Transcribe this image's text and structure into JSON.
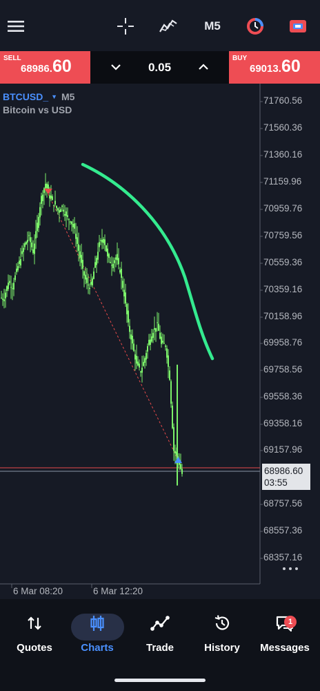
{
  "toolbar": {
    "menu_icon": "hamburger-icon",
    "crosshair_icon": "crosshair-icon",
    "indicators_icon": "indicators-icon",
    "timeframe": "M5",
    "chart_settings_icon": "chart-settings-icon",
    "trade_icon": "one-click-trade-icon"
  },
  "trade_panel": {
    "sell": {
      "label": "SELL",
      "price_small": "68986.",
      "price_big": "60"
    },
    "buy": {
      "label": "BUY",
      "price_small": "69013.",
      "price_big": "60"
    },
    "lot": "0.05"
  },
  "chart": {
    "symbol": "BTCUSD_",
    "timeframe": "M5",
    "description": "Bitcoin vs USD",
    "y_labels": [
      "71760.56",
      "71560.36",
      "71360.16",
      "71159.96",
      "70959.76",
      "70759.56",
      "70559.36",
      "70359.16",
      "70158.96",
      "69958.76",
      "69758.56",
      "69558.36",
      "69358.16",
      "69157.96",
      "68757.56",
      "68557.36",
      "68357.16"
    ],
    "current_price": "68986.60",
    "countdown": "03:55",
    "x_labels": [
      "6 Mar 08:20",
      "6 Mar 12:20"
    ],
    "colors": {
      "up": "#7cf26a",
      "bid_line": "#e84a4a",
      "ask_line": "#8a96a8",
      "drawing": "#34eb8f"
    }
  },
  "chart_data": {
    "type": "line",
    "title": "",
    "xlabel": "",
    "ylabel": "",
    "ylim": [
      68257.06,
      71860.66
    ],
    "xticks": [
      "6 Mar 08:20",
      "6 Mar 12:20"
    ],
    "series": [
      {
        "values": [
          70300,
          70420,
          70380,
          70500,
          70600,
          70700,
          70750,
          70640,
          70850,
          71050,
          71150,
          71050,
          71000,
          70950,
          70980,
          70900,
          70880,
          70800,
          70650,
          70500,
          70400,
          70380,
          70550,
          70700,
          70750,
          70600,
          70550,
          70600,
          70500,
          70320,
          70100,
          69950,
          69800,
          69750,
          69850,
          69980,
          70050,
          70100,
          69950,
          69950,
          69700,
          69160,
          69100,
          68986
        ]
      }
    ],
    "trade_markers": [
      {
        "type": "sell",
        "price": 71100
      },
      {
        "type": "buy",
        "price": 69000
      }
    ],
    "grid": false
  },
  "bottom_nav": {
    "items": [
      {
        "label": "Quotes",
        "icon": "sort-arrows-icon"
      },
      {
        "label": "Charts",
        "icon": "candlesticks-icon"
      },
      {
        "label": "Trade",
        "icon": "trend-line-icon"
      },
      {
        "label": "History",
        "icon": "history-icon"
      },
      {
        "label": "Messages",
        "icon": "messages-icon"
      }
    ],
    "badge": "1"
  }
}
